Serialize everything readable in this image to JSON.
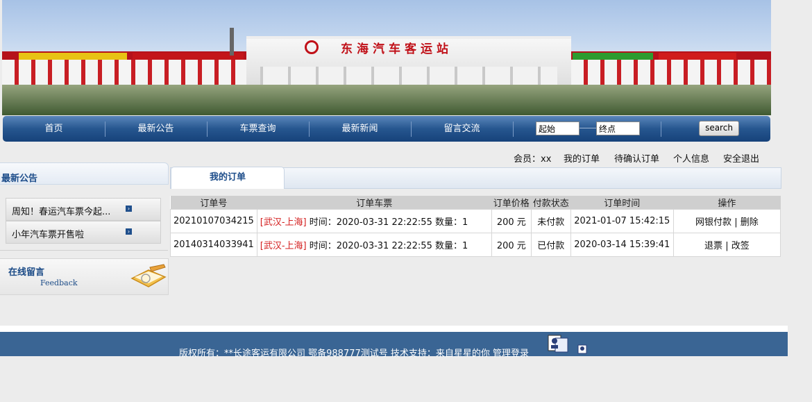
{
  "banner": {
    "title": "东海汽车客运站"
  },
  "nav": {
    "items": [
      "首页",
      "最新公告",
      "车票查询",
      "最新新闻",
      "留言交流"
    ],
    "start_value": "起始",
    "end_value": "终点",
    "search_label": "search"
  },
  "userbar": {
    "member_label": "会员：xx",
    "links": [
      "我的订单",
      "待确认订单",
      "个人信息",
      "安全退出"
    ]
  },
  "sidebar": {
    "title": "最新公告",
    "items": [
      "周知！春运汽车票今起...",
      "小年汽车票开售啦"
    ],
    "feedback_zh": "在线留言",
    "feedback_en": "Feedback"
  },
  "tabs": {
    "active": "我的订单"
  },
  "orders": {
    "headers": [
      "订单号",
      "订单车票",
      "订单价格",
      "付款状态",
      "订单时间",
      "操作"
    ],
    "rows": [
      {
        "id": "20210107034215",
        "route": "[武汉-上海]",
        "detail": " 时间：2020-03-31 22:22:55 数量：1",
        "price": "200 元",
        "status": "未付款",
        "time": "2021-01-07 15:42:15",
        "action1": "网银付款",
        "sep": " | ",
        "action2": "删除"
      },
      {
        "id": "20140314033941",
        "route": "[武汉-上海]",
        "detail": " 时间：2020-03-31 22:22:55 数量：1",
        "price": "200 元",
        "status": "已付款",
        "time": "2020-03-14 15:39:41",
        "action1": "退票",
        "sep": " | ",
        "action2": "改签"
      }
    ]
  },
  "footer": {
    "copyright": "版权所有：**长途客运有限公司  鄂备988777测试号  技术支持：来自星星的你",
    "admin": "管理登录"
  },
  "colors": {
    "nav": "#26568f",
    "route": "#d41f1f",
    "footer": "#3a6594",
    "accent": "#1d4d8a"
  },
  "icons": [
    "chevron-right-icon",
    "book-pen-icon",
    "admin-card-icon",
    "small-card-icon"
  ]
}
